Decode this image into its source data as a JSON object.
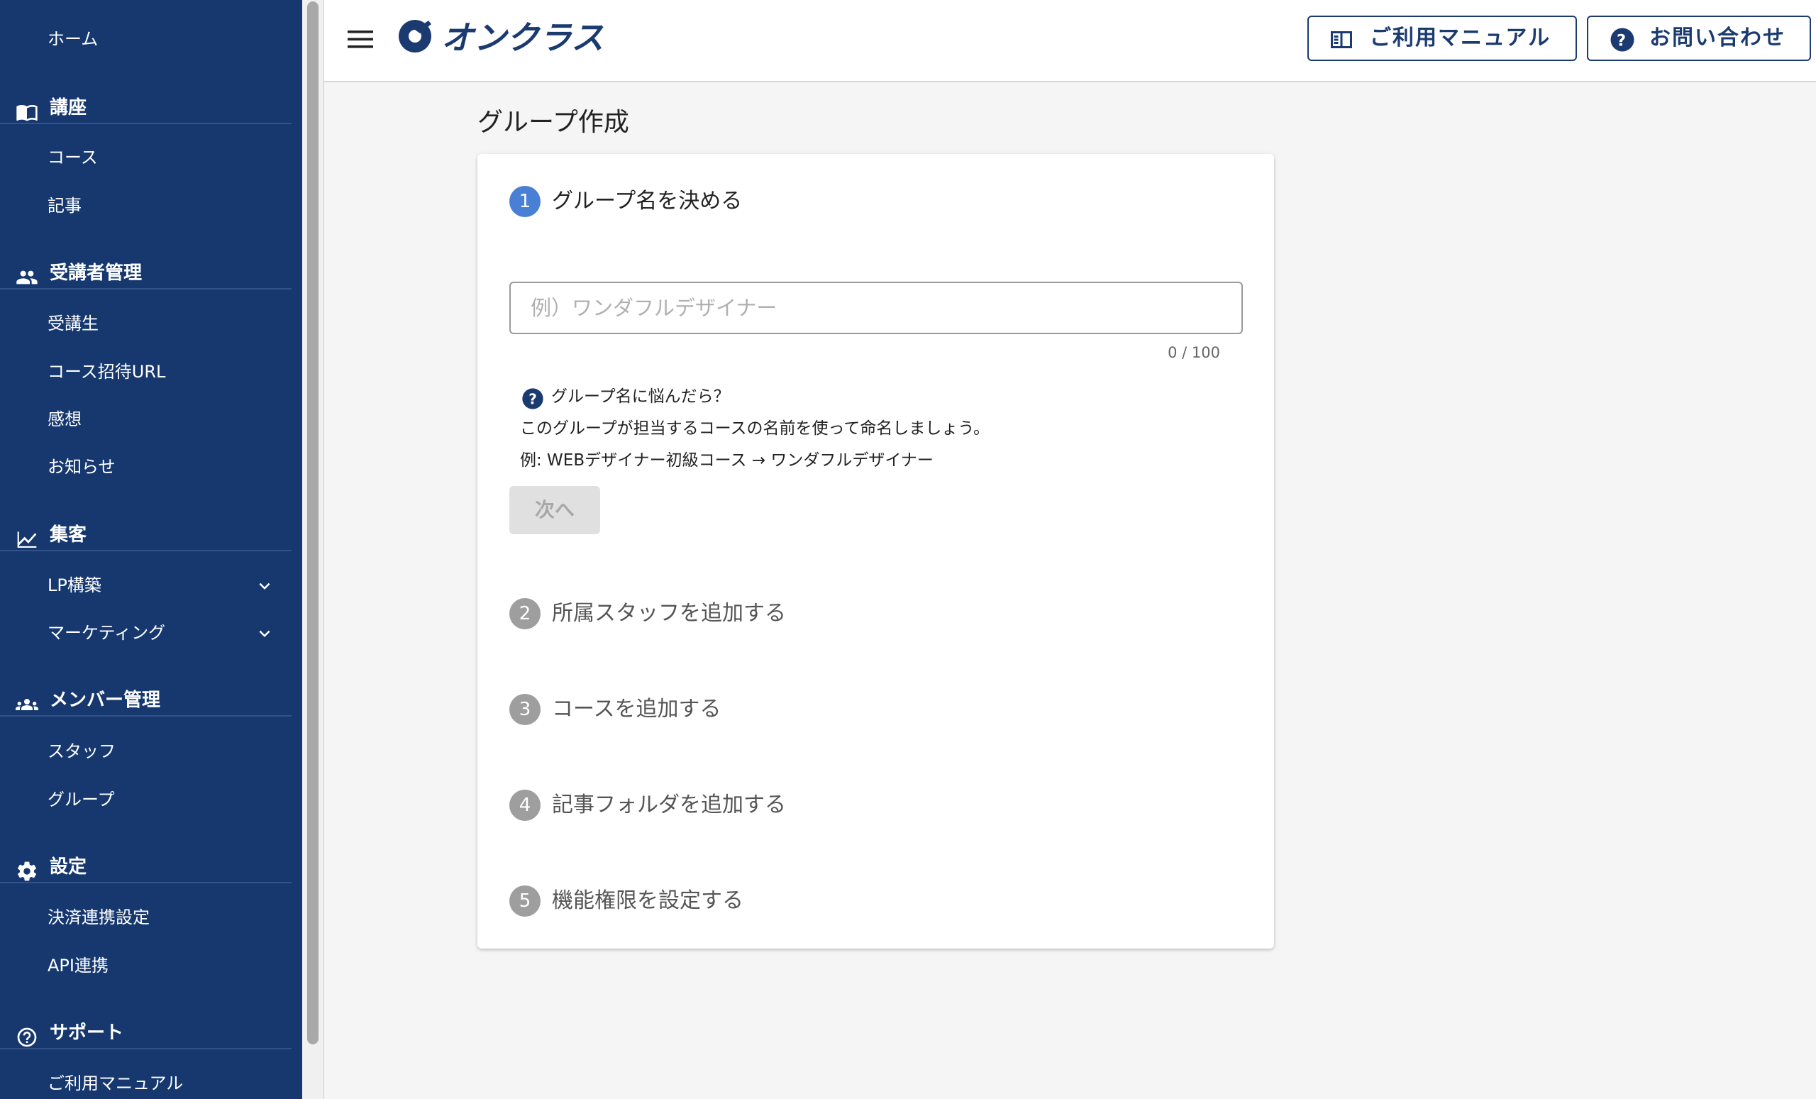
{
  "sidebar": {
    "home": "ホーム",
    "sections": [
      {
        "title": "講座",
        "icon": "book-open-icon",
        "items": [
          "コース",
          "記事"
        ]
      },
      {
        "title": "受講者管理",
        "icon": "people-icon",
        "items": [
          "受講生",
          "コース招待URL",
          "感想",
          "お知らせ"
        ]
      },
      {
        "title": "集客",
        "icon": "line-chart-icon",
        "items": [
          "LP構築",
          "マーケティング"
        ]
      },
      {
        "title": "メンバー管理",
        "icon": "group-icon",
        "items": [
          "スタッフ",
          "グループ"
        ]
      },
      {
        "title": "設定",
        "icon": "gear-icon",
        "items": [
          "決済連携設定",
          "API連携"
        ]
      },
      {
        "title": "サポート",
        "icon": "help-circle-icon",
        "items": [
          "ご利用マニュアル"
        ]
      }
    ]
  },
  "header": {
    "logo_text": "オンクラス",
    "manual_button": "ご利用マニュアル",
    "contact_button": "お問い合わせ"
  },
  "main": {
    "page_title": "グループ作成",
    "steps": [
      {
        "number": "1",
        "label": "グループ名を決める",
        "state": "active"
      },
      {
        "number": "2",
        "label": "所属スタッフを追加する",
        "state": "inactive"
      },
      {
        "number": "3",
        "label": "コースを追加する",
        "state": "inactive"
      },
      {
        "number": "4",
        "label": "記事フォルダを追加する",
        "state": "inactive"
      },
      {
        "number": "5",
        "label": "機能権限を設定する",
        "state": "inactive"
      }
    ],
    "name_input": {
      "value": "",
      "placeholder": "例）ワンダフルデザイナー",
      "counter": "0 / 100"
    },
    "help": {
      "title": "グループ名に悩んだら？",
      "line1": "このグループが担当するコースの名前を使って命名しましょう。",
      "line2": "例: WEBデザイナー初級コース → ワンダフルデザイナー"
    },
    "next_button": "次へ"
  },
  "colors": {
    "sidebar_bg": "#16386f",
    "accent": "#4a7fd6",
    "brand_navy": "#1b3b70",
    "inactive_step": "#9e9e9e"
  }
}
